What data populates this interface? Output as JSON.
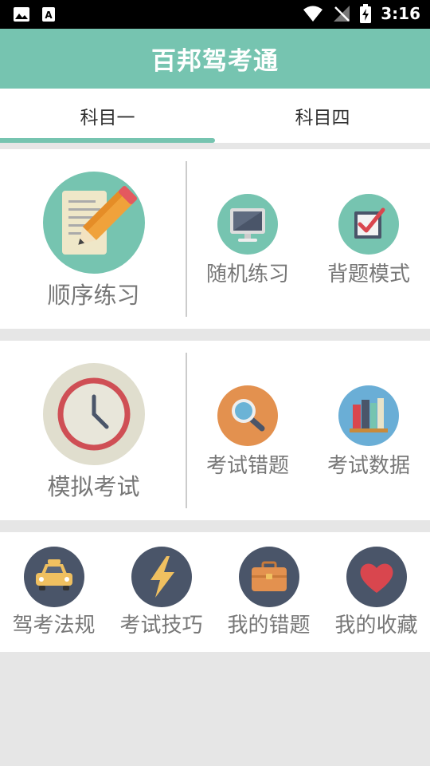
{
  "status_bar": {
    "time": "3:16"
  },
  "app": {
    "title": "百邦驾考通"
  },
  "tabs": [
    {
      "label": "科目一",
      "active": true
    },
    {
      "label": "科目四",
      "active": false
    }
  ],
  "section1": {
    "main": {
      "label": "顺序练习",
      "icon": "notepad-pencil-icon"
    },
    "items": [
      {
        "label": "随机练习",
        "icon": "monitor-icon"
      },
      {
        "label": "背题模式",
        "icon": "checkbox-icon"
      }
    ]
  },
  "section2": {
    "main": {
      "label": "模拟考试",
      "icon": "clock-icon"
    },
    "items": [
      {
        "label": "考试错题",
        "icon": "magnifier-icon"
      },
      {
        "label": "考试数据",
        "icon": "books-icon"
      }
    ]
  },
  "section3": {
    "items": [
      {
        "label": "驾考法规",
        "icon": "car-icon"
      },
      {
        "label": "考试技巧",
        "icon": "lightning-icon"
      },
      {
        "label": "我的错题",
        "icon": "briefcase-icon"
      },
      {
        "label": "我的收藏",
        "icon": "heart-icon"
      }
    ]
  },
  "colors": {
    "accent": "#76c4b0",
    "statusbar": "#000000",
    "background": "#e6e6e6",
    "label_gray": "#777777",
    "dark_icon_bg": "#4a5569"
  }
}
